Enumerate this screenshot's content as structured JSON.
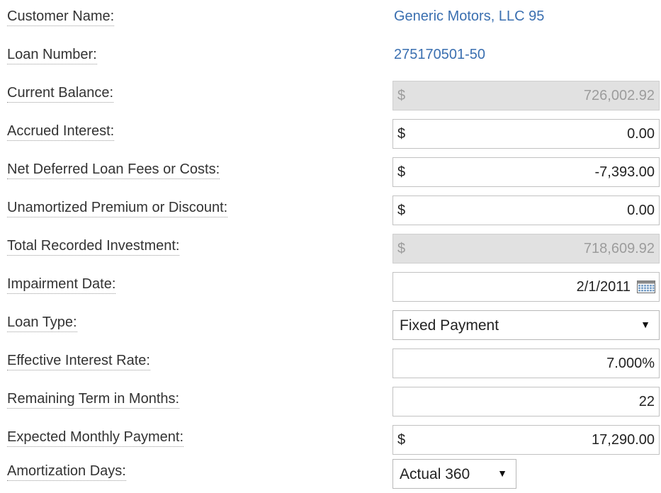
{
  "form": {
    "customer_name": {
      "label": "Customer Name:",
      "value": "Generic Motors, LLC 95"
    },
    "loan_number": {
      "label": "Loan Number:",
      "value": "275170501-50"
    },
    "current_balance": {
      "label": "Current Balance:",
      "currency": "$",
      "value": "726,002.92"
    },
    "accrued_interest": {
      "label": "Accrued Interest:",
      "currency": "$",
      "value": "0.00"
    },
    "net_deferred_fees": {
      "label": "Net Deferred Loan Fees or Costs:",
      "currency": "$",
      "value": "-7,393.00"
    },
    "unamortized_premium": {
      "label": "Unamortized Premium or Discount:",
      "currency": "$",
      "value": "0.00"
    },
    "total_recorded_investment": {
      "label": "Total Recorded Investment:",
      "currency": "$",
      "value": "718,609.92"
    },
    "impairment_date": {
      "label": "Impairment Date:",
      "value": "2/1/2011"
    },
    "loan_type": {
      "label": "Loan Type:",
      "selected": "Fixed Payment"
    },
    "effective_interest_rate": {
      "label": "Effective Interest Rate:",
      "value": "7.000%"
    },
    "remaining_term": {
      "label": "Remaining Term in Months:",
      "value": "22"
    },
    "expected_monthly_payment": {
      "label": "Expected Monthly Payment:",
      "currency": "$",
      "value": "17,290.00"
    },
    "amortization_days": {
      "label": "Amortization Days:",
      "selected": "Actual 360"
    }
  },
  "icons": {
    "calendar": "calendar-icon",
    "dropdown_arrow": "▼"
  },
  "colors": {
    "link": "#3a6fb0",
    "readonly_bg": "#e1e1e1",
    "label": "#333333"
  }
}
